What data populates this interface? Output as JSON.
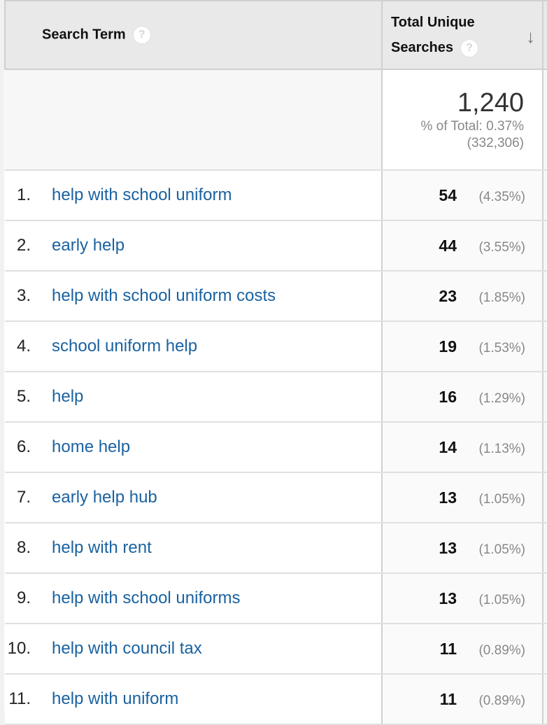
{
  "table": {
    "columns": {
      "search_term": "Search Term",
      "metric_line1": "Total Unique",
      "metric_line2": "Searches",
      "help_icon": "?",
      "sort_icon": "↓"
    },
    "summary": {
      "total": "1,240",
      "percent_of_total": "% of Total: 0.37%",
      "grand_total": "(332,306)"
    },
    "rows": [
      {
        "index": "1.",
        "term": "help with school uniform",
        "value": "54",
        "percent": "(4.35%)"
      },
      {
        "index": "2.",
        "term": "early help",
        "value": "44",
        "percent": "(3.55%)"
      },
      {
        "index": "3.",
        "term": "help with school uniform costs",
        "value": "23",
        "percent": "(1.85%)"
      },
      {
        "index": "4.",
        "term": "school uniform help",
        "value": "19",
        "percent": "(1.53%)"
      },
      {
        "index": "5.",
        "term": "help",
        "value": "16",
        "percent": "(1.29%)"
      },
      {
        "index": "6.",
        "term": "home help",
        "value": "14",
        "percent": "(1.13%)"
      },
      {
        "index": "7.",
        "term": "early help hub",
        "value": "13",
        "percent": "(1.05%)"
      },
      {
        "index": "8.",
        "term": "help with rent",
        "value": "13",
        "percent": "(1.05%)"
      },
      {
        "index": "9.",
        "term": "help with school uniforms",
        "value": "13",
        "percent": "(1.05%)"
      },
      {
        "index": "10.",
        "term": "help with council tax",
        "value": "11",
        "percent": "(0.89%)"
      },
      {
        "index": "11.",
        "term": "help with uniform",
        "value": "11",
        "percent": "(0.89%)"
      }
    ]
  },
  "colors": {
    "link": "#1a62a0",
    "header_bg": "#e9e9e9",
    "muted_text": "#888888"
  }
}
